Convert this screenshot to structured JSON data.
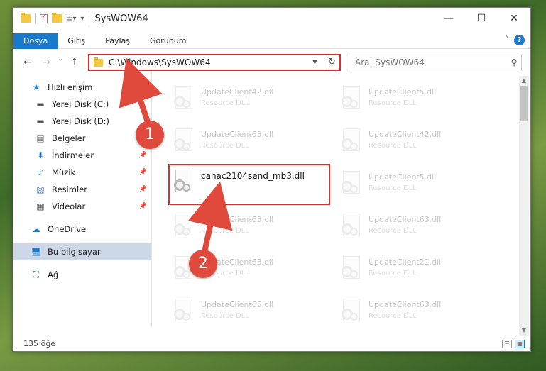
{
  "window": {
    "title": "SysWOW64",
    "controls": {
      "minimize": "—",
      "maximize": "☐",
      "close": "✕"
    }
  },
  "ribbon": {
    "tabs": [
      "Dosya",
      "Giriş",
      "Paylaş",
      "Görünüm"
    ],
    "help": "?"
  },
  "navigation": {
    "back": "←",
    "forward": "→",
    "recent": "˅",
    "up": "↑",
    "address": "C:\\Windows\\SysWOW64",
    "search_placeholder": "Ara: SysWOW64"
  },
  "sidebar": {
    "quick_access": "Hızlı erişim",
    "items": [
      {
        "label": "Yerel Disk (C:)",
        "icon": "drive-icon",
        "pinned": false
      },
      {
        "label": "Yerel Disk (D:)",
        "icon": "drive-icon",
        "pinned": false
      },
      {
        "label": "Belgeler",
        "icon": "documents-icon",
        "pinned": false
      },
      {
        "label": "İndirmeler",
        "icon": "downloads-icon",
        "pinned": true
      },
      {
        "label": "Müzik",
        "icon": "music-icon",
        "pinned": true
      },
      {
        "label": "Resimler",
        "icon": "pictures-icon",
        "pinned": true
      },
      {
        "label": "Videolar",
        "icon": "videos-icon",
        "pinned": true
      }
    ],
    "onedrive": "OneDrive",
    "this_pc": "Bu bilgisayar",
    "network": "Ağ"
  },
  "files": {
    "left_column": [
      {
        "name": "UpdateClient42.dll",
        "type": "Resource DLL"
      },
      {
        "name": "UpdateClient63.dll",
        "type": "Resource DLL"
      },
      {
        "name": "UpdateClient63.dll",
        "type": "Resource DLL"
      },
      {
        "name": "UpdateClient63.dll",
        "type": "Resource DLL"
      },
      {
        "name": "UpdateClient65.dll",
        "type": "Resource DLL"
      }
    ],
    "right_column": [
      {
        "name": "UpdateClient5.dll",
        "type": "Resource DLL"
      },
      {
        "name": "UpdateClient42.dll",
        "type": "Resource DLL"
      },
      {
        "name": "UpdateClient5.dll",
        "type": "Resource DLL"
      },
      {
        "name": "UpdateClient63.dll",
        "type": "Resource DLL"
      },
      {
        "name": "UpdateClient21.dll",
        "type": "Resource DLL"
      },
      {
        "name": "UpdateClient63.dll",
        "type": "Resource DLL"
      }
    ],
    "highlighted": {
      "name": "canac2104send_mb3.dll"
    }
  },
  "status": {
    "item_count": "135 öğe"
  },
  "annotations": {
    "step1": "1",
    "step2": "2",
    "color": "#e04a3c"
  }
}
